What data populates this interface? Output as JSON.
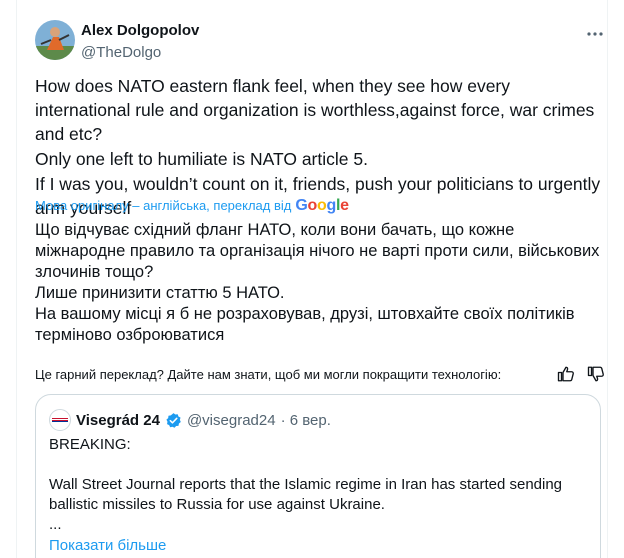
{
  "author": {
    "name": "Alex Dolgopolov",
    "handle": "@TheDolgo"
  },
  "tweet": {
    "lines": [
      "How does NATO eastern flank feel, when they see how every international rule and organization is worthless,against force, war crimes and etc?",
      "Only one left to humiliate is NATO article 5.",
      "If I was you, wouldn’t count on it, friends, push your politicians to urgently arm yourself"
    ]
  },
  "translation": {
    "label": "Мова оригіналу – англійська, переклад від",
    "provider": "Google",
    "lines": [
      "Що відчуває східний фланг НАТО, коли вони бачать, що кожне міжнародне правило та організація нічого не варті проти сили, військових злочинів тощо?",
      "Лише принизити статтю 5 НАТО.",
      "На вашому місці я б не розраховував, друзі, штовхайте своїх політиків терміново озброюватися"
    ],
    "feedback": "Це гарний переклад? Дайте нам знати, щоб ми могли покращити технологію:"
  },
  "quote": {
    "name": "Visegrád 24",
    "handle": "@visegrad24",
    "time": "· 6 вер.",
    "lines": [
      "BREAKING:",
      "Wall Street Journal reports that the Islamic regime in Iran has started sending ballistic missiles to Russia for use against Ukraine.",
      "..."
    ],
    "show_more": "Показати більше"
  },
  "colors": {
    "accent": "#1d9bf0",
    "text": "#0f1419",
    "secondary": "#536471",
    "border": "#cfd9de"
  },
  "icons": [
    "more-horizontal-icon",
    "thumbs-up-icon",
    "thumbs-down-icon",
    "verified-badge-icon"
  ]
}
